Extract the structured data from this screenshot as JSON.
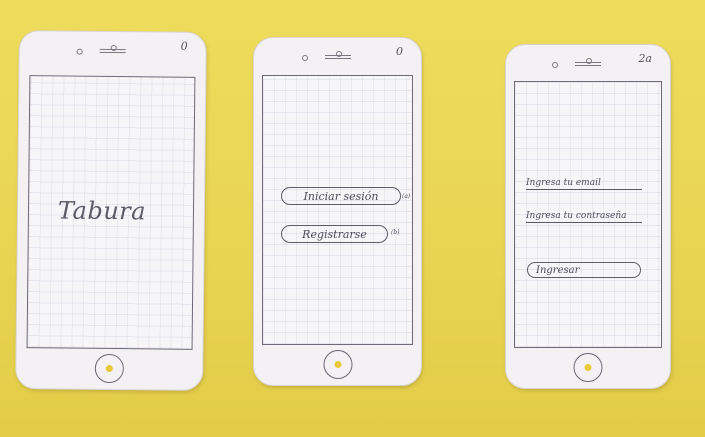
{
  "screen1": {
    "page_number": "0",
    "logo": "Tabura"
  },
  "screen2": {
    "page_number": "0",
    "login_button": "Iniciar sesión",
    "login_tag": "(a)",
    "register_button": "Registrarse",
    "register_tag": "(b)"
  },
  "screen3": {
    "page_number": "2a",
    "email_field": "Ingresa tu email",
    "password_field": "Ingresa tu contraseña",
    "submit_button": "Ingresar"
  },
  "icons": {
    "speaker": "speaker-slot",
    "camera": "front-camera",
    "home": "home-button"
  },
  "colors": {
    "paper": "#f3f1f4",
    "background": "#eedc5c",
    "ink": "#5c5a66",
    "home_dot": "#e9c83a"
  }
}
